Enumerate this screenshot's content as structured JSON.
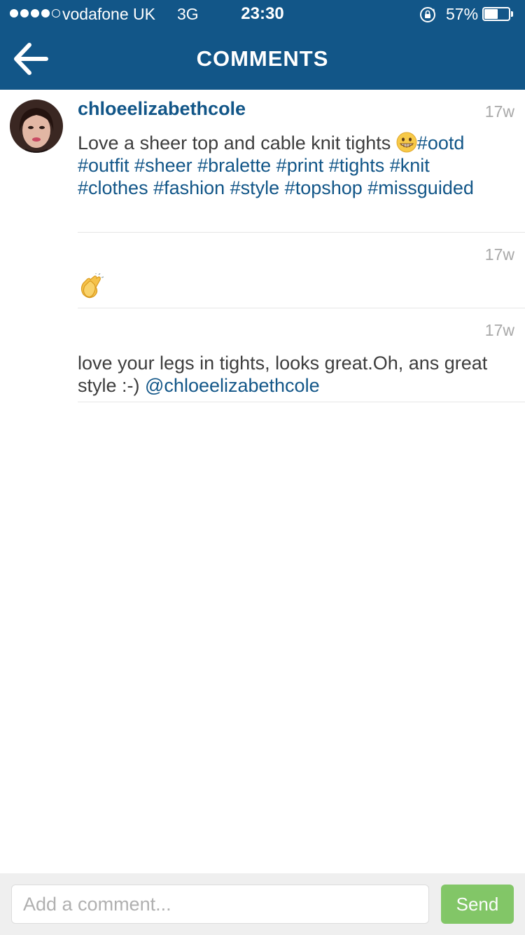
{
  "status_bar": {
    "carrier": "vodafone UK",
    "network": "3G",
    "time": "23:30",
    "battery_percent_label": "57%",
    "battery_level": 0.57,
    "signal_bars_filled": 4,
    "signal_bars_total": 5
  },
  "nav": {
    "title": "COMMENTS",
    "back_icon": "arrow-left-icon"
  },
  "comments": [
    {
      "username": "chloeelizabethcole",
      "time": "17w",
      "text_plain": "Love a sheer top and cable knit tights ",
      "emoji": "grinning-face",
      "hashtags_line1": "#ootd",
      "hashtags_rest": "#outfit #sheer #bralette #print #tights #knit #clothes #fashion #style #topshop #missguided"
    },
    {
      "username": "",
      "time": "17w",
      "emoji": "clapping-hands"
    },
    {
      "username": "",
      "time": "17w",
      "text_plain": "love your legs in tights, looks great.Oh, ans great style :-) ",
      "mention": "@chloeelizabethcole"
    }
  ],
  "comment_bar": {
    "placeholder": "Add a comment...",
    "send_label": "Send"
  },
  "colors": {
    "header_blue": "#125688",
    "link_blue": "#125688",
    "send_green": "#70c050",
    "timestamp_gray": "#a8a8a8"
  }
}
